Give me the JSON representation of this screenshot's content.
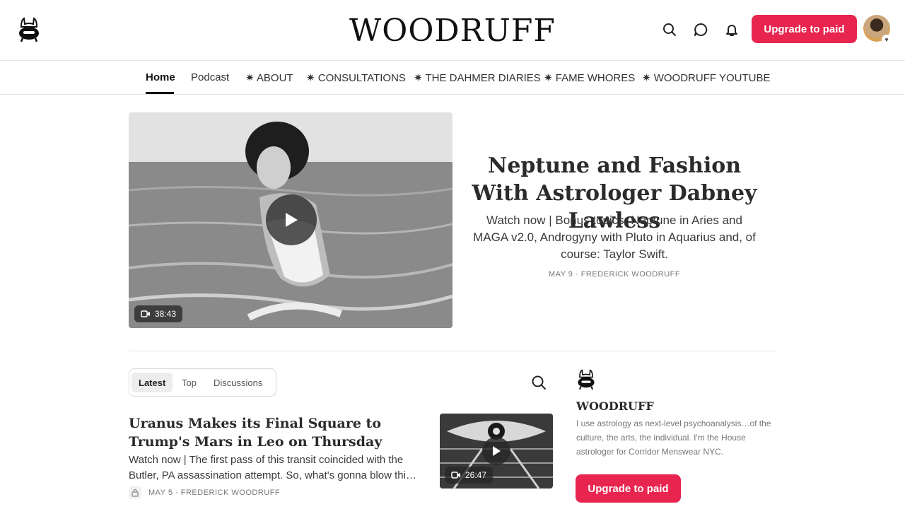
{
  "header": {
    "brand": "WOODRUFF",
    "icons": [
      "search-icon",
      "chat-icon",
      "bell-icon"
    ],
    "upgrade_label": "Upgrade to paid"
  },
  "nav": {
    "items": [
      {
        "label": "Home"
      },
      {
        "label": "Podcast"
      },
      {
        "label": "✷ ABOUT"
      },
      {
        "label": "✷ CONSULTATIONS"
      },
      {
        "label": "✷ THE DAHMER DIARIES"
      },
      {
        "label": "✷ FAME WHORES"
      },
      {
        "label": "✷ WOODRUFF YOUTUBE"
      }
    ],
    "active": "Home"
  },
  "hero": {
    "title": "Neptune and Fashion With Astrologer Dabney Lawless",
    "subtitle": "Watch now | Bonus topics: Neptune in Aries and MAGA v2.0, Androgyny with Pluto in Aquarius and, of course: Taylor Swift.",
    "meta": "MAY 9 · FREDERICK WOODRUFF",
    "duration": "38:43"
  },
  "tabs": {
    "items": [
      "Latest",
      "Top",
      "Discussions"
    ],
    "active": "Latest"
  },
  "post": {
    "title": "Uranus Makes its Final Square to Trump's Mars in Leo on Thursday",
    "subtitle": "Watch now | The first pass of this transit coincided with the Butler, PA assassination attempt. So, what's gonna blow thi…",
    "meta": "MAY 5 · FREDERICK WOODRUFF",
    "duration": "26:47"
  },
  "sidebar": {
    "name": "WOODRUFF",
    "description": "I use astrology as next-level psychoanalysis…of the culture, the arts, the individual. I'm the House astrologer for Corridor Menswear NYC.",
    "upgrade_label": "Upgrade to paid"
  },
  "colors": {
    "accent": "#e8254f",
    "text": "#2b2b2b",
    "muted": "#777777"
  }
}
